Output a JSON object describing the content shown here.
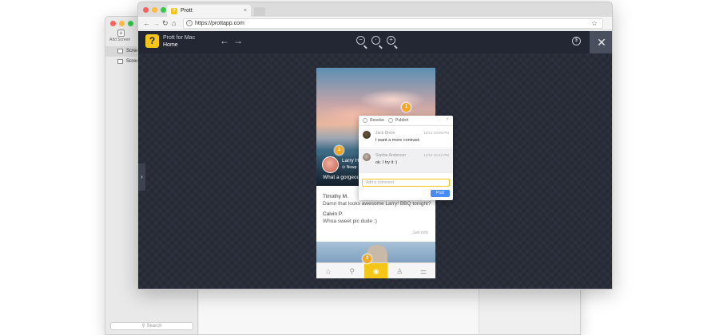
{
  "bg_app": {
    "add_screen_label": "Add Screen",
    "add_icon": "plus-icon",
    "list_items": [
      {
        "label": "Scree",
        "selected": true
      },
      {
        "label": "Scree",
        "selected": false
      }
    ],
    "search_placeholder": "Search",
    "search_icon": "magnifier-icon"
  },
  "browser": {
    "tab_title": "Prott",
    "tab_close": "×",
    "url": "https://prottapp.com",
    "nav": {
      "back": "←",
      "forward": "→",
      "reload": "↻",
      "home": "⌂"
    },
    "bookmark_icon": "☆"
  },
  "app": {
    "logo_glyph": "?",
    "name": "Prott for Mac",
    "screen": "Home",
    "nav_back": "←",
    "nav_forward": "→",
    "zoom_out": "−",
    "zoom_reset": "·",
    "zoom_in": "+",
    "coin": "$",
    "close": "✕",
    "side_toggle": "›",
    "accent": "#f5c518",
    "pin_color": "#f5a623"
  },
  "phone": {
    "user": "Larry Ha",
    "location": "⊙ Newp",
    "caption": "What a gorgeous",
    "comments": [
      {
        "name": "Timothy M.",
        "text": "Damn that looks awesome Larry! BBQ tonight?"
      },
      {
        "name": "Calvin P.",
        "text": "Whoa sweet pic dude :)"
      }
    ],
    "comments_time": "Just now",
    "tabs": [
      {
        "icon": "home-icon",
        "glyph": "⌂",
        "active": false
      },
      {
        "icon": "search-icon",
        "glyph": "⚲",
        "active": false
      },
      {
        "icon": "camera-icon",
        "glyph": "◉",
        "active": true
      },
      {
        "icon": "profile-icon",
        "glyph": "♙",
        "active": false
      },
      {
        "icon": "settings-icon",
        "glyph": "⚌",
        "active": false
      }
    ]
  },
  "pins": [
    "1",
    "2",
    "3"
  ],
  "popup": {
    "resolve_label": "Resolve",
    "publish_label": "Publish",
    "close": "×",
    "messages": [
      {
        "name": "Jack Dixon",
        "time": "12/12 10:09 PM",
        "text": "I want a more contrast."
      },
      {
        "name": "Sophie Anderson",
        "time": "12/12 10:42 PM",
        "text": "ok. I try it :)"
      }
    ],
    "input_placeholder": "Add a comment",
    "post_label": "Post"
  }
}
